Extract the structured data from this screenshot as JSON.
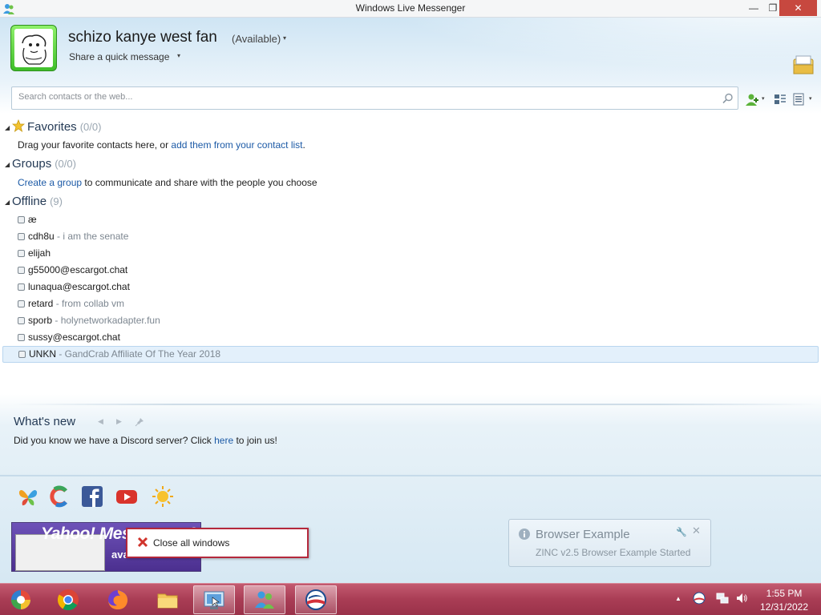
{
  "window": {
    "title": "Windows Live Messenger",
    "min_glyph": "—",
    "max_glyph": "❐",
    "close_glyph": "✕"
  },
  "profile": {
    "display_name": "schizo kanye west fan",
    "status": "(Available)",
    "quick_message": "Share a quick message",
    "arrow": "▾"
  },
  "search": {
    "placeholder": "Search contacts or the web..."
  },
  "groups": {
    "favorites": {
      "title": "Favorites",
      "count": "(0/0)",
      "desc_prefix": "Drag your favorite contacts here, or ",
      "desc_link": "add them from your contact list",
      "desc_suffix": "."
    },
    "groups": {
      "title": "Groups",
      "count": "(0/0)",
      "desc_link": "Create a group",
      "desc_suffix": " to communicate and share with the people you choose"
    },
    "offline": {
      "title": "Offline",
      "count": "(9)"
    }
  },
  "contacts": [
    {
      "name": "æ",
      "psm": ""
    },
    {
      "name": "cdh8u",
      "psm": " - i am the senate"
    },
    {
      "name": "elijah",
      "psm": ""
    },
    {
      "name": "g55000@escargot.chat",
      "psm": ""
    },
    {
      "name": "lunaqua@escargot.chat",
      "psm": ""
    },
    {
      "name": "retard",
      "psm": " - from collab vm"
    },
    {
      "name": "sporb",
      "psm": " - holynetworkadapter.fun"
    },
    {
      "name": "sussy@escargot.chat",
      "psm": ""
    },
    {
      "name": "UNKN",
      "psm": " - GandCrab Affiliate Of The Year 2018"
    }
  ],
  "whats_new": {
    "title": "What's new",
    "text_prefix": "Did you know we have a Discord server? Click ",
    "link": "here",
    "text_suffix": " to join us!"
  },
  "ad": {
    "line1": "Yahoo! Messenger 6",
    "line2": "avail NIN"
  },
  "jump_list": {
    "close_all": "Close all windows"
  },
  "toast": {
    "title": "Browser Example",
    "subtitle": "ZINC v2.5 Browser Example Started",
    "close_glyph": "✕"
  },
  "taskbar": {
    "time": "1:55 PM",
    "date": "12/31/2022",
    "tray_arrow": "▲"
  },
  "colors": {
    "taskbar": "#a93d55",
    "link": "#1c5aa6",
    "avatar_frame": "#3fbf2a",
    "close_button": "#c7483f",
    "jump_border": "#b4283c"
  }
}
